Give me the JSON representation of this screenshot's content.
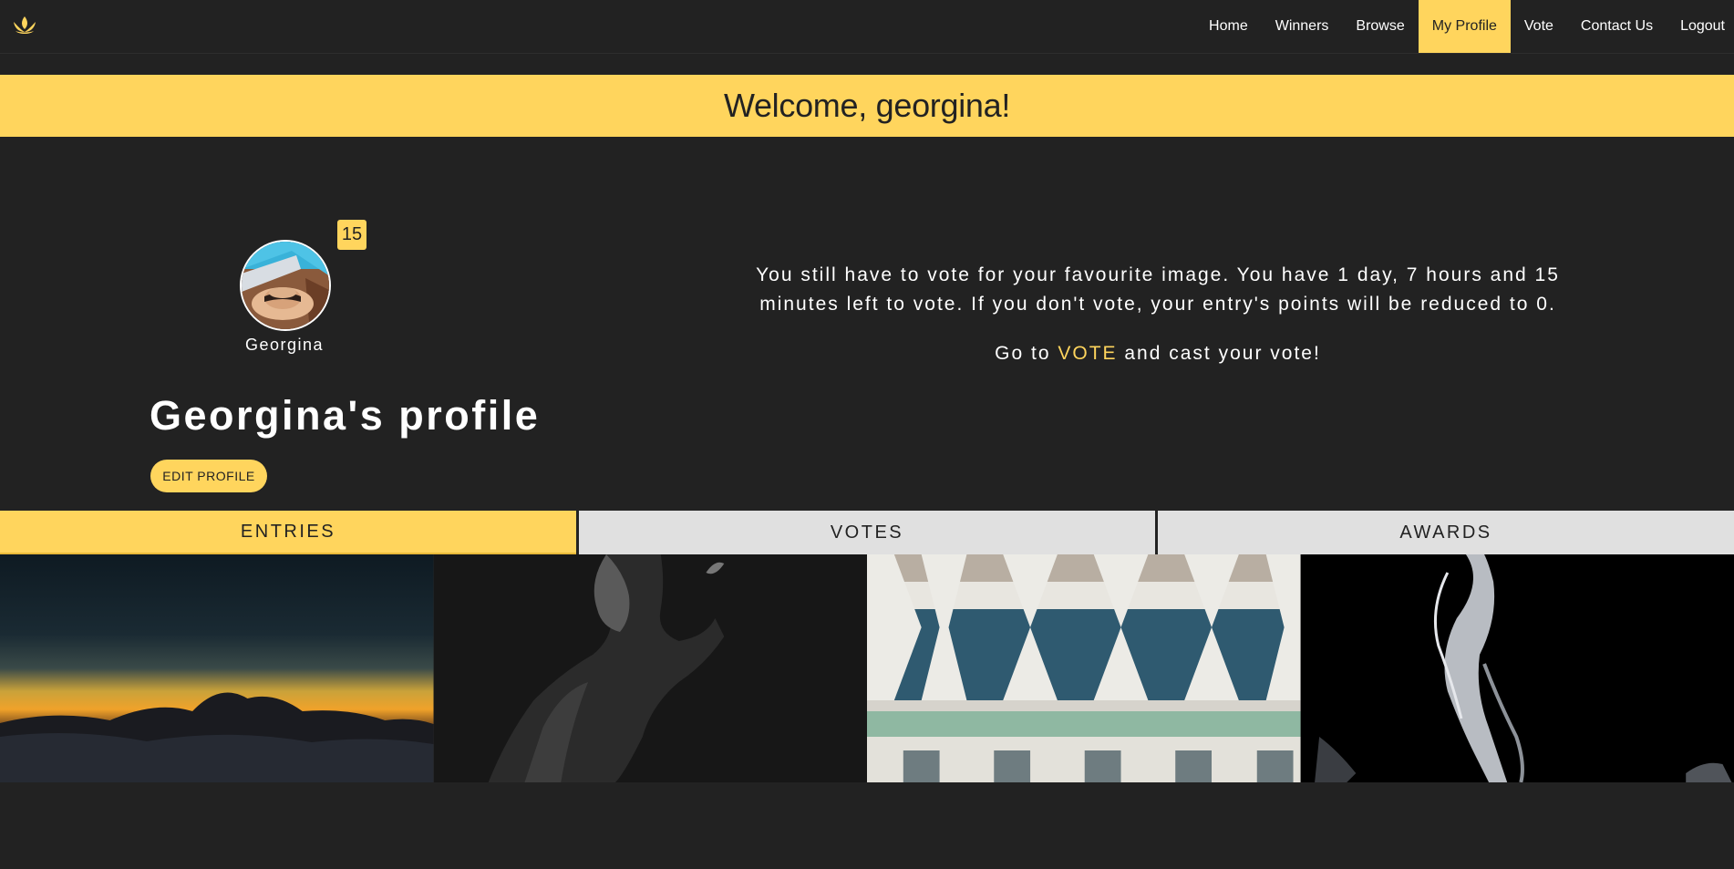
{
  "nav": {
    "logo_icon": "lotus-logo-icon",
    "links": [
      {
        "label": "Home"
      },
      {
        "label": "Winners"
      },
      {
        "label": "Browse"
      },
      {
        "label": "My Profile",
        "active": true
      },
      {
        "label": "Vote"
      },
      {
        "label": "Contact Us"
      },
      {
        "label": "Logout"
      }
    ]
  },
  "banner": {
    "text": "Welcome, georgina!"
  },
  "profile": {
    "score": "15",
    "username": "Georgina",
    "title": "Georgina's profile",
    "edit_label": "EDIT PROFILE"
  },
  "vote_notice": {
    "message": "You still have to vote for your favourite image. You have 1 day, 7 hours and 15 minutes left to vote. If you don't vote, your entry's points will be reduced to 0.",
    "cta_prefix": "Go to ",
    "cta_link": "VOTE",
    "cta_suffix": " and cast your vote!"
  },
  "tabs": [
    {
      "label": "ENTRIES",
      "active": true
    },
    {
      "label": "VOTES"
    },
    {
      "label": "AWARDS"
    }
  ],
  "colors": {
    "accent": "#ffd55d",
    "background": "#222222",
    "tab_inactive": "#e0e0e0"
  }
}
